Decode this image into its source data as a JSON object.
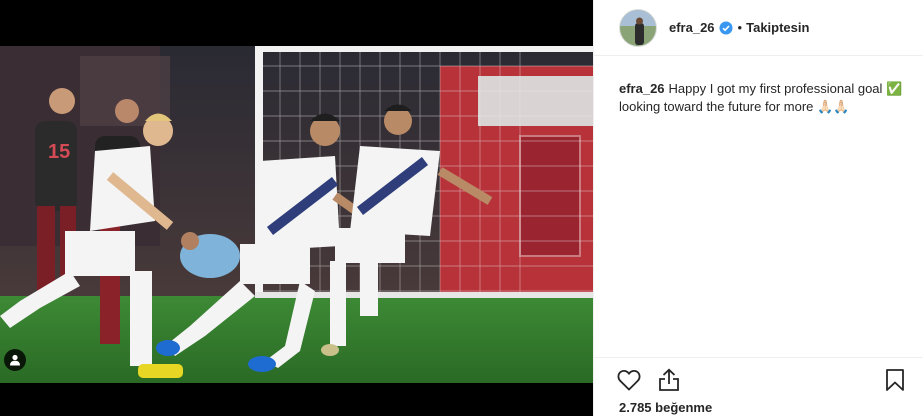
{
  "post": {
    "username": "efra_26",
    "follow_state": "Takiptesin",
    "separator": "•",
    "caption_user": "efra_26",
    "caption_text": "Happy I got my first professional goal ✅ looking toward the future for more 🙏🏻🙏🏻",
    "likes": "2.785 beğenme"
  },
  "colors": {
    "verified": "#3897f0",
    "text": "#262626",
    "border": "#efefef",
    "pitch": "#2f7a2a"
  },
  "icons": {
    "verified": "verified-badge-icon",
    "like": "heart-icon",
    "share": "share-icon",
    "save": "bookmark-icon",
    "user_tags": "person-icon"
  }
}
